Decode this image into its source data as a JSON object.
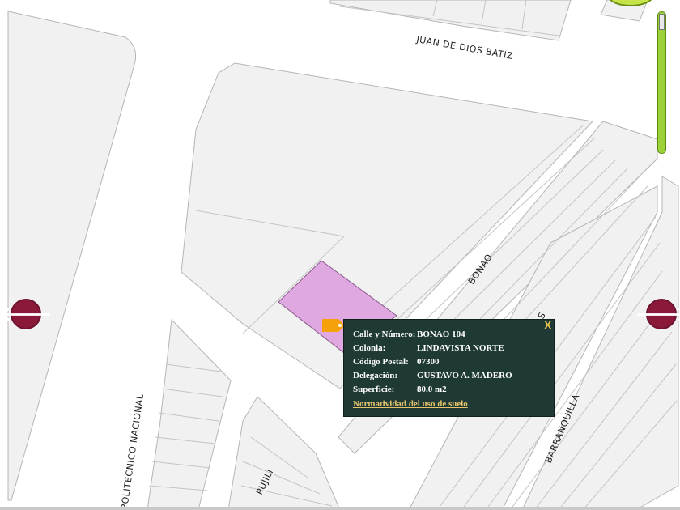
{
  "map": {
    "streets": {
      "juan_de_dios_batiz": "JUAN DE DIOS BATIZ",
      "bonao": "BONAO",
      "barranquilla": "BARRANQUILLA",
      "politecnico": "POLITECNICO NACIONAL",
      "pujili": "PUJILI",
      "barras": "BARRAS"
    },
    "highlight_color": "#e0a8e0",
    "road_color": "#ffffff",
    "block_color": "#f1f1f1"
  },
  "navigation": {
    "prev_arrow": "🡐",
    "next_arrow": "🡒",
    "arrow_color": "#8b1a3a",
    "prev_icon": "arrow-left-icon",
    "next_icon": "arrow-right-icon"
  },
  "zoom": {
    "level": 0.95,
    "color": "#9bd23a"
  },
  "popup": {
    "close_label": "X",
    "rows": [
      {
        "key": "Calle y Número:",
        "value": "BONAO 104"
      },
      {
        "key": "Colonia:",
        "value": "LINDAVISTA NORTE"
      },
      {
        "key": "Código Postal:",
        "value": "07300"
      },
      {
        "key": "Delegación:",
        "value": "GUSTAVO A. MADERO"
      },
      {
        "key": "Superficie:",
        "value": "80.0 m2"
      }
    ],
    "link": "Normatividad del uso de suelo",
    "background": "#1f3a34",
    "link_color": "#e6c46b"
  }
}
